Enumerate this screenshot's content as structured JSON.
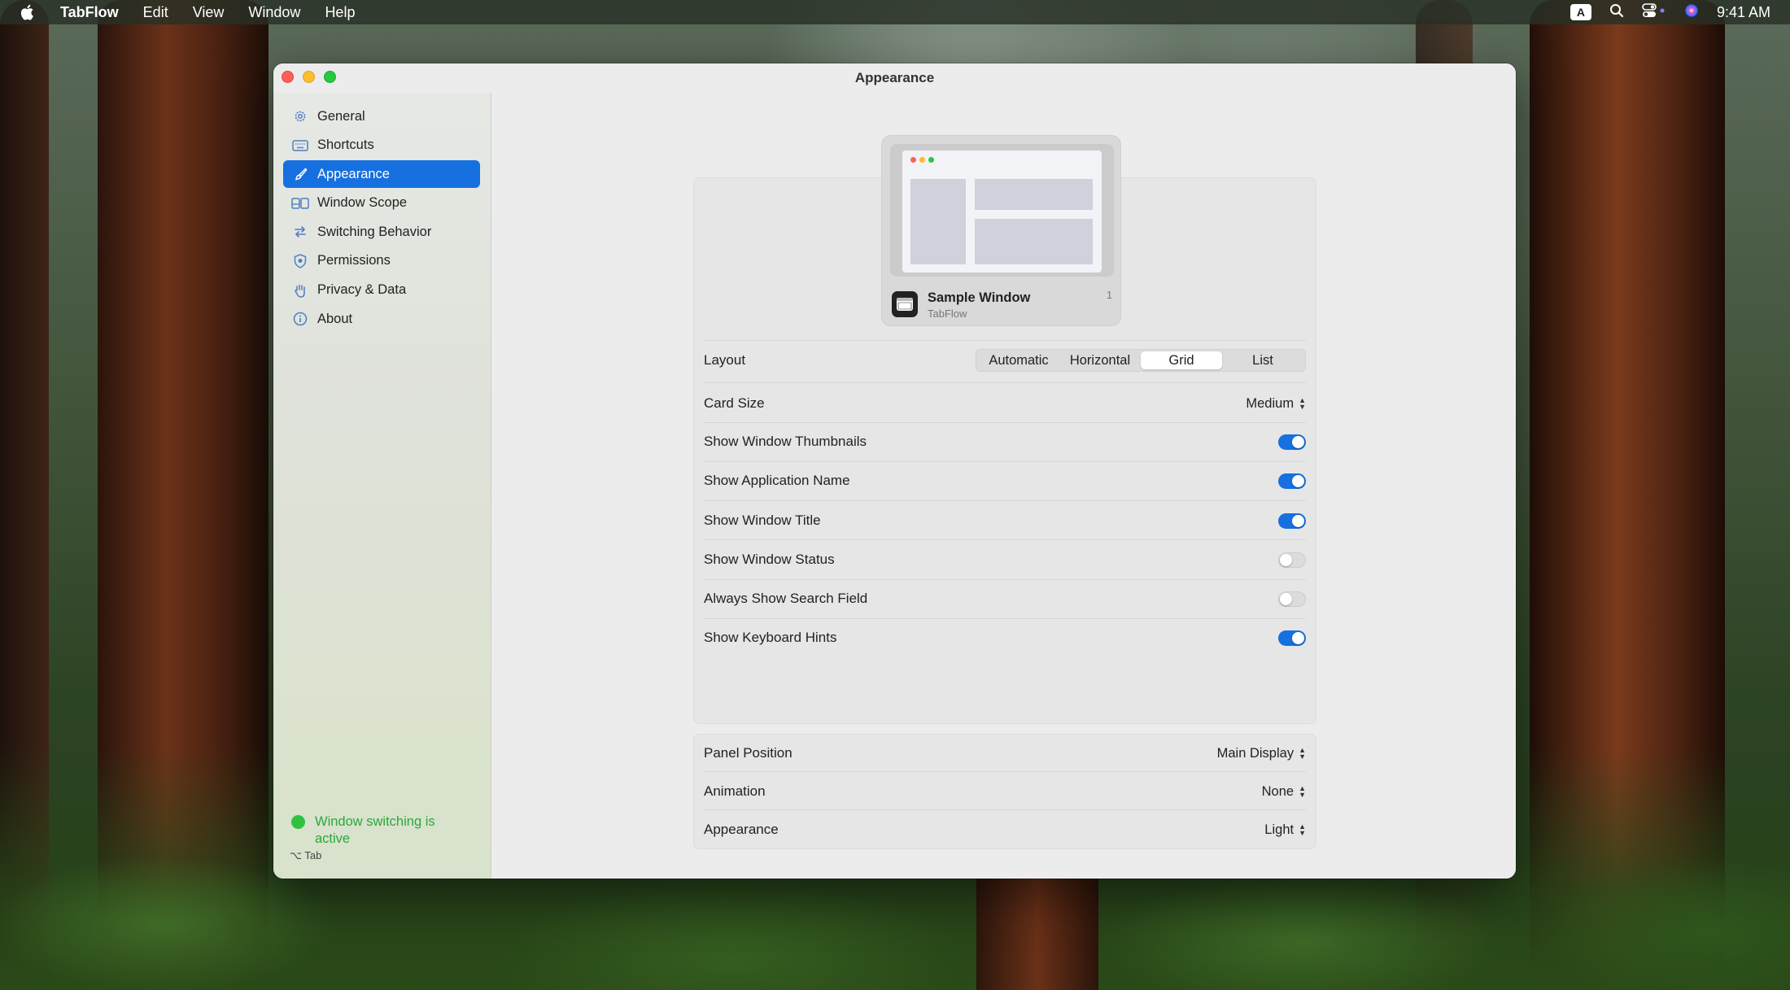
{
  "menubar": {
    "app_name": "TabFlow",
    "menus": [
      "Edit",
      "View",
      "Window",
      "Help"
    ],
    "input_badge": "A",
    "clock": "9:41 AM"
  },
  "window": {
    "title": "Appearance"
  },
  "sidebar": {
    "items": [
      {
        "label": "General",
        "icon": "gear-icon"
      },
      {
        "label": "Shortcuts",
        "icon": "keyboard-icon"
      },
      {
        "label": "Appearance",
        "icon": "paintbrush-icon",
        "active": true
      },
      {
        "label": "Window Scope",
        "icon": "window-scope-icon"
      },
      {
        "label": "Switching Behavior",
        "icon": "arrows-swap-icon"
      },
      {
        "label": "Permissions",
        "icon": "shield-icon"
      },
      {
        "label": "Privacy & Data",
        "icon": "hand-icon"
      },
      {
        "label": "About",
        "icon": "info-icon"
      }
    ],
    "status": {
      "text": "Window switching is active",
      "shortcut": "⌥ Tab",
      "color": "#2fc13f"
    }
  },
  "preview": {
    "title": "Sample Window",
    "app": "TabFlow",
    "number": "1"
  },
  "settings": {
    "layout": {
      "label": "Layout",
      "options": [
        "Automatic",
        "Horizontal",
        "Grid",
        "List"
      ],
      "selected": "Grid"
    },
    "card_size": {
      "label": "Card Size",
      "value": "Medium"
    },
    "toggles": [
      {
        "label": "Show Window Thumbnails",
        "on": true
      },
      {
        "label": "Show Application Name",
        "on": true
      },
      {
        "label": "Show Window Title",
        "on": true
      },
      {
        "label": "Show Window Status",
        "on": false
      },
      {
        "label": "Always Show Search Field",
        "on": false
      },
      {
        "label": "Show Keyboard Hints",
        "on": true
      }
    ],
    "panel_position": {
      "label": "Panel Position",
      "value": "Main Display"
    },
    "animation": {
      "label": "Animation",
      "value": "None"
    },
    "appearance": {
      "label": "Appearance",
      "value": "Light"
    }
  },
  "colors": {
    "accent": "#1670e0",
    "toggle_off": "#dcdcdc"
  }
}
